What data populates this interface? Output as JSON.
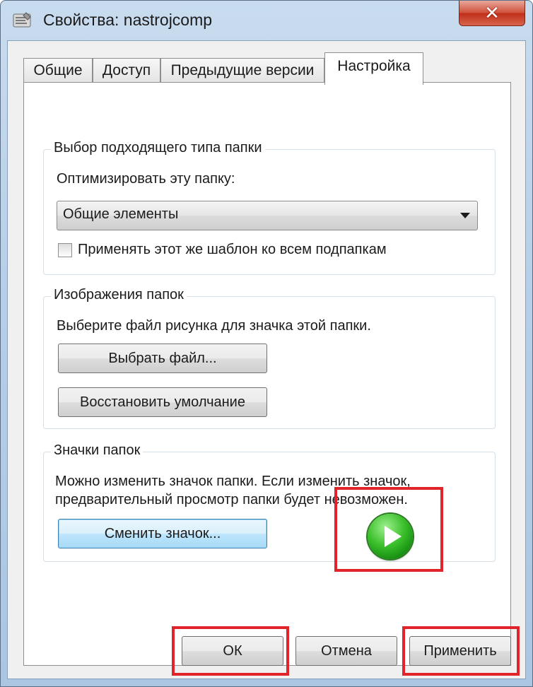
{
  "window": {
    "title": "Свойства: nastrojcomp",
    "close_glyph": "✕"
  },
  "tabs": [
    {
      "label": "Общие"
    },
    {
      "label": "Доступ"
    },
    {
      "label": "Предыдущие версии"
    },
    {
      "label": "Настройка",
      "active": true
    }
  ],
  "folder_type": {
    "legend": "Выбор подходящего типа папки",
    "optimize_label": "Оптимизировать эту папку:",
    "dropdown_value": "Общие элементы",
    "checkbox_label": "Применять этот же шаблон ко всем подпапкам",
    "checkbox_checked": false
  },
  "folder_pictures": {
    "legend": "Изображения папок",
    "description": "Выберите файл рисунка для значка этой папки.",
    "choose_file_label": "Выбрать файл...",
    "restore_default_label": "Восстановить умолчание"
  },
  "folder_icons": {
    "legend": "Значки папок",
    "description_line1": "Можно изменить значок папки. Если изменить значок,",
    "description_line2": "предварительный просмотр папки будет невозможен.",
    "change_icon_label": "Сменить значок..."
  },
  "footer": {
    "ok_label": "ОК",
    "cancel_label": "Отмена",
    "apply_label": "Применить"
  },
  "colors": {
    "highlight": "#e1232a",
    "play_icon": "#2fa81f"
  },
  "icons": {
    "title_icon": "properties-icon",
    "preview_icon": "play-icon"
  }
}
